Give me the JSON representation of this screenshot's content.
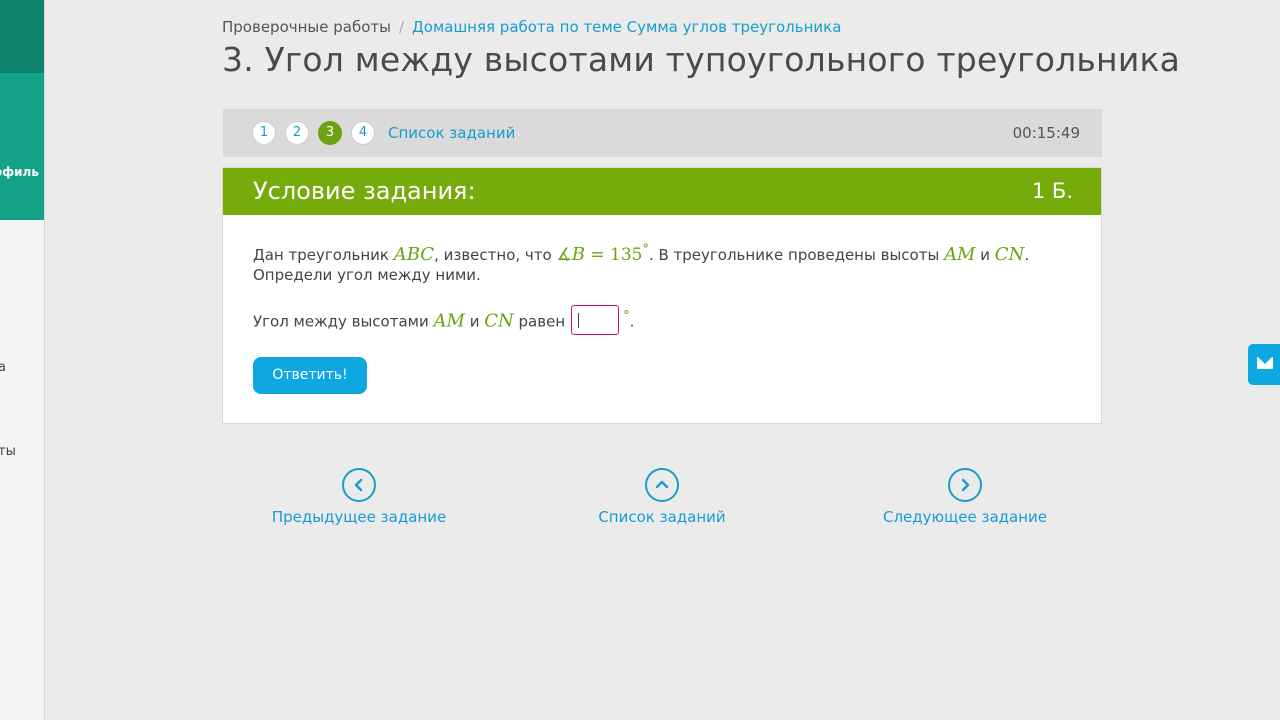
{
  "sidebar": {
    "profile_label": "офиль",
    "item_a_label": "а",
    "item_b_label": "ты"
  },
  "breadcrumb": {
    "root": "Проверочные работы",
    "separator": "/",
    "current": "Домашняя работа по теме Сумма углов треугольника"
  },
  "page_title": "3. Угол между высотами тупоугольного треугольника",
  "task_bar": {
    "tasks": [
      "1",
      "2",
      "3",
      "4"
    ],
    "active_task": "3",
    "task_list_label": "Список заданий",
    "timer": "00:15:49"
  },
  "card": {
    "title": "Условие задания:",
    "points": "1 Б.",
    "problem": {
      "t1": "Дан треугольник ",
      "m1": "ABC",
      "t2": ", известно, что ",
      "m2_angle": "∡",
      "m2_b": "B",
      "m2_eq": " = 135",
      "m2_deg": "°",
      "t3": ". В треугольнике проведены высоты ",
      "m3": "AM",
      "t4": " и ",
      "m4": "CN",
      "t5": ". Определи угол между ними."
    },
    "answer": {
      "t1": "Угол между высотами ",
      "m1": "AM",
      "t2": " и ",
      "m2": "CN",
      "t3": " равен",
      "input_value": "",
      "degree": "°",
      "end": "."
    },
    "submit_label": "Ответить!"
  },
  "bottom_nav": {
    "prev_label": "Предыдущее задание",
    "list_label": "Список заданий",
    "next_label": "Следующее задание"
  },
  "icons": {
    "prev": "chevron-left-icon",
    "list": "chevron-up-icon",
    "next": "chevron-right-icon",
    "mail": "envelope-icon"
  },
  "colors": {
    "header_green": "#75ab0b",
    "link_blue": "#1a9bcf",
    "button_blue": "#0fa7e2",
    "sidebar_teal": "#14a389"
  }
}
